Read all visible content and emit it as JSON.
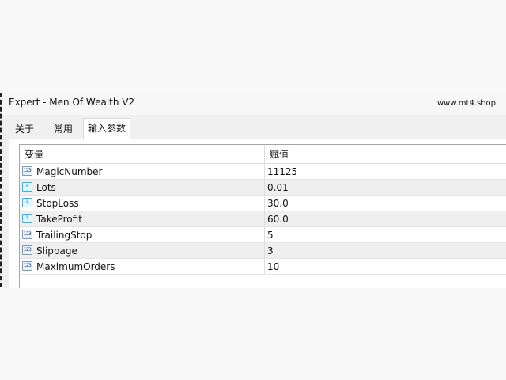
{
  "window": {
    "title": "Expert - Men Of Wealth V2",
    "watermark": "www.mt4.shop"
  },
  "tabs": [
    {
      "label": "关于",
      "active": false
    },
    {
      "label": "常用",
      "active": false
    },
    {
      "label": "输入参数",
      "active": true
    }
  ],
  "parameters": {
    "columns": [
      "变量",
      "赋值"
    ],
    "rows": [
      {
        "name": "MagicNumber",
        "value": "11125",
        "icon_text": "123",
        "icon_name": "integer-parameter-icon"
      },
      {
        "name": "Lots",
        "value": "0.01",
        "icon_text": "½",
        "icon_name": "double-parameter-icon"
      },
      {
        "name": "StopLoss",
        "value": "30.0",
        "icon_text": "½",
        "icon_name": "double-parameter-icon"
      },
      {
        "name": "TakeProfit",
        "value": "60.0",
        "icon_text": "½",
        "icon_name": "double-parameter-icon"
      },
      {
        "name": "TrailingStop",
        "value": "5",
        "icon_text": "123",
        "icon_name": "integer-parameter-icon"
      },
      {
        "name": "Slippage",
        "value": "3",
        "icon_text": "123",
        "icon_name": "integer-parameter-icon"
      },
      {
        "name": "MaximumOrders",
        "value": "10",
        "icon_text": "123",
        "icon_name": "integer-parameter-icon"
      }
    ]
  },
  "colors": {
    "background": "#f8f8f8",
    "selected_tab": "#ffffff",
    "alternate_row": "#efefef",
    "grid_line": "#e5e5e5",
    "double_icon": "#28b5ff",
    "integer_icon": "#7f98b3"
  }
}
